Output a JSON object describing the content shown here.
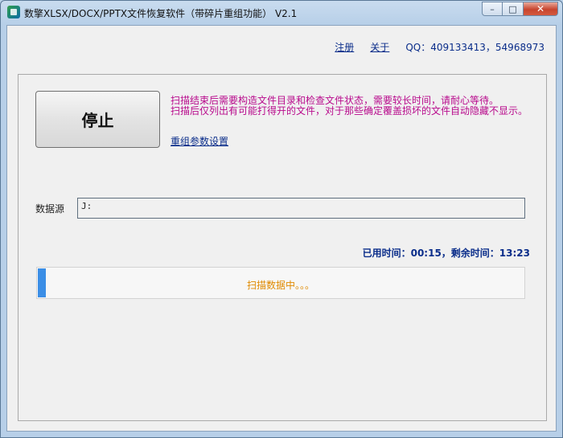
{
  "window": {
    "title": "数擎XLSX/DOCX/PPTX文件恢复软件（带碎片重组功能） V2.1",
    "controls": {
      "minimize": "–",
      "maximize": "□",
      "close": "✕"
    }
  },
  "toplinks": {
    "register": "注册",
    "about": "关于",
    "qq": "QQ：409133413，54968973"
  },
  "main": {
    "stop_button": "停止",
    "notes": [
      "扫描结束后需要构造文件目录和检查文件状态，需要较长时间，请耐心等待。",
      "扫描后仅列出有可能打得开的文件，对于那些确定覆盖损坏的文件自动隐藏不显示。"
    ],
    "settings_link": "重组参数设置",
    "datasource": {
      "label": "数据源",
      "value": "J:"
    },
    "time_info": "已用时间：00:15，剩余时间：13:23",
    "progress": {
      "fraction": 0.017,
      "status": "扫描数据中。。。"
    }
  },
  "colors": {
    "note": "#b80a8c",
    "link": "#0a2d8a",
    "status": "#e08a00",
    "progress": "#3b8ee6"
  }
}
